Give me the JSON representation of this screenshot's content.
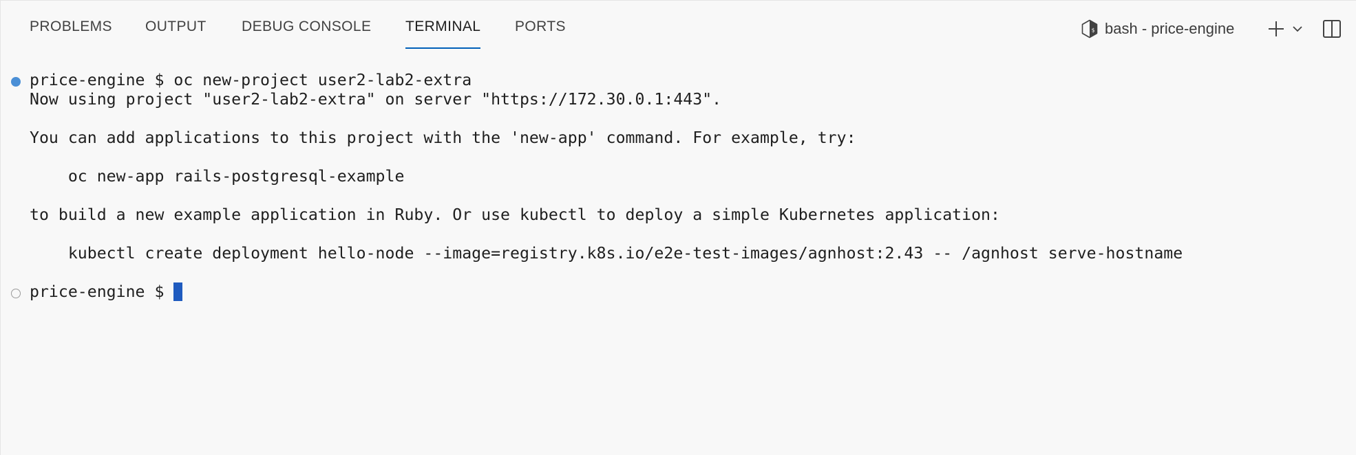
{
  "panel": {
    "tabs": [
      {
        "label": "PROBLEMS",
        "active": false
      },
      {
        "label": "OUTPUT",
        "active": false
      },
      {
        "label": "DEBUG CONSOLE",
        "active": false
      },
      {
        "label": "TERMINAL",
        "active": true
      },
      {
        "label": "PORTS",
        "active": false
      }
    ],
    "terminal_selector": {
      "icon": "terminal-bash-icon",
      "label": "bash - price-engine"
    },
    "actions": [
      {
        "name": "new-terminal",
        "icon": "plus-icon"
      },
      {
        "name": "launch-profile",
        "icon": "chevron-down-icon"
      },
      {
        "name": "split-terminal",
        "icon": "split-editor-icon"
      }
    ],
    "accent_color": "#005fb8"
  },
  "terminal": {
    "prompt": "price-engine $ ",
    "lines": [
      "price-engine $ oc new-project user2-lab2-extra",
      "Now using project \"user2-lab2-extra\" on server \"https://172.30.0.1:443\".",
      "",
      "You can add applications to this project with the 'new-app' command. For example, try:",
      "",
      "    oc new-app rails-postgresql-example",
      "",
      "to build a new example application in Ruby. Or use kubectl to deploy a simple Kubernetes application:",
      "",
      "    kubectl create deployment hello-node --image=registry.k8s.io/e2e-test-images/agnhost:2.43 -- /agnhost serve-hostname",
      "",
      "price-engine $ "
    ],
    "decorations": [
      {
        "line": 0,
        "status": "success",
        "color": "#4a8fd6"
      },
      {
        "line": 11,
        "status": "empty"
      }
    ],
    "cursor_color": "#1f5bbf"
  }
}
